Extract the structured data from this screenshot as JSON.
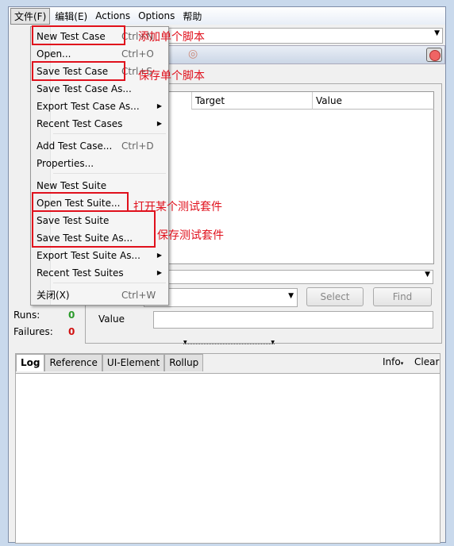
{
  "menubar": {
    "items": [
      "文件(F)",
      "编辑(E)",
      "Actions",
      "Options",
      "帮助"
    ]
  },
  "file_menu": {
    "items": [
      {
        "label": "New Test Case",
        "shortcut": "Ctrl+N"
      },
      {
        "label": "Open...",
        "shortcut": "Ctrl+O"
      },
      {
        "label": "Save Test Case",
        "shortcut": "Ctrl+S"
      },
      {
        "label": "Save Test Case As..."
      },
      {
        "label": "Export Test Case As...",
        "submenu": true
      },
      {
        "label": "Recent Test Cases",
        "submenu": true
      },
      {
        "label": "Add Test Case...",
        "shortcut": "Ctrl+D"
      },
      {
        "label": "Properties..."
      },
      {
        "label": "New Test Suite"
      },
      {
        "label": "Open Test Suite..."
      },
      {
        "label": "Save Test Suite"
      },
      {
        "label": "Save Test Suite As..."
      },
      {
        "label": "Export Test Suite As...",
        "submenu": true
      },
      {
        "label": "Recent Test Suites",
        "submenu": true
      },
      {
        "label": "关闭(X)",
        "shortcut": "Ctrl+W"
      }
    ]
  },
  "annotations": {
    "new_case": "添加单个脚本",
    "save_case": "保存单个脚本",
    "open_suite": "打开某个测试套件",
    "save_suite": "保存测试套件"
  },
  "table": {
    "columns": [
      "Target",
      "Value"
    ]
  },
  "editor": {
    "select_label": "Select",
    "find_label": "Find",
    "value_label": "Value"
  },
  "stats": {
    "runs_label": "Runs:",
    "runs": "0",
    "failures_label": "Failures:",
    "failures": "0"
  },
  "log": {
    "tabs": [
      "Log",
      "Reference",
      "UI-Element",
      "Rollup"
    ],
    "info": "Info",
    "clear": "Clear"
  },
  "colors": {
    "annotation": "#e0101c",
    "runs": "#2a9a2a",
    "failures": "#d01010"
  }
}
